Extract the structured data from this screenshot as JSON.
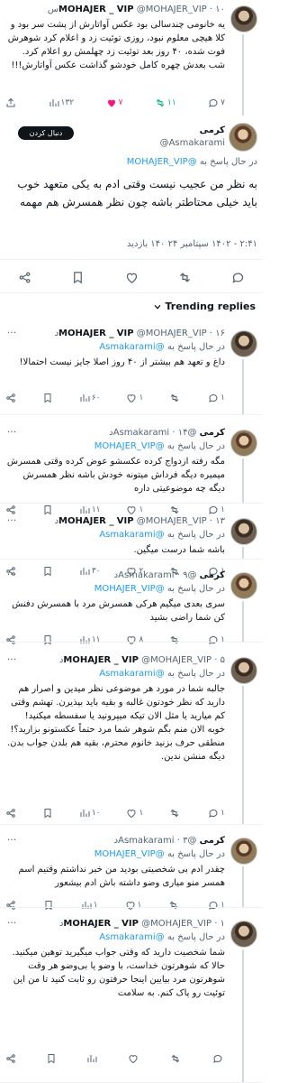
{
  "top_tweet": {
    "handle": "@MOHAJER_VIP",
    "name": "MOHAJER _ VIP",
    "time": "۱۰س",
    "text": "یه خانومی چندسالی بود عکس آواتارش از پشت سر بود و کلا هیچی معلوم نبود، روزی توئیت زد و اعلام کرد شوهرش فوت شده، ۴۰ روز بعد توئیت زد چهلمش رو اعلام کرد. شب بعدش چهره کامل خودشو گذاشت عکس آواتارش!!!",
    "stats": {
      "views": "۱۳۲",
      "retweets": "۱۱",
      "likes": "۷",
      "replies": "۷"
    }
  },
  "main_tweet": {
    "name": "کرمی",
    "handle": "@Asmakarami",
    "follow_label": "دنبال کردن",
    "reply_prefix": "در حال پاسخ به",
    "reply_to": "@MOHAJER_VIP",
    "text": "به نظر من عجیب نیست وقتی ادم به یکی متعهد خوب باید خیلی محتاطتر باشه چون نظر همسرش هم مهمه",
    "timestamp": "۲:۴۱ - ۱۴۰۲ سپتامبر ۲۴ ۱۴۰ بازدید"
  },
  "trending_label": "Trending replies",
  "replies": [
    {
      "name": "MOHAJER _ VIP",
      "handle": "@MOHAJER_VIP",
      "time": "۱۶د",
      "reply_to": "@Asmakarami",
      "text": "داغ و تعهد هم بیشتر از ۴۰ روز اصلا جایز نیست احتمالا!",
      "stats": {
        "replies": "۱",
        "retweets": "",
        "likes": "۱",
        "views": "۶۰"
      }
    },
    {
      "name": "کرمی",
      "handle": "@Asmakarami",
      "time": "۱۴د",
      "reply_to": "@MOHAJER_VIP",
      "text": "مگه رفته ازدواج کرده عکسشو عوض کرده وقتی همسرش میمیره دیگه فرداش میتونه خودش باشه نظر همسرش دیگه چه موضوعیتی داره",
      "stats": {
        "replies": "۱",
        "retweets": "",
        "likes": "۱",
        "views": "۱۱"
      }
    },
    {
      "name": "MOHAJER _ VIP",
      "handle": "@MOHAJER_VIP",
      "time": "۱۳د",
      "reply_to": "@Asmakarami",
      "text": "باشه شما درست میگین.",
      "stats": {
        "replies": "۱",
        "retweets": "",
        "likes": "۲",
        "views": "۳۰"
      }
    },
    {
      "name": "کرمی",
      "handle": "@Asmakarami",
      "time": "۹د",
      "reply_to": "@MOHAJER_VIP",
      "text": "سری بعدی میگیم هرکی همسرش مرد با همسرش دفنش کن شما راضی بشید",
      "stats": {
        "replies": "۱",
        "retweets": "",
        "likes": "۸",
        "views": "۱۱"
      }
    },
    {
      "name": "MOHAJER _ VIP",
      "handle": "@MOHAJER_VIP",
      "time": "۵د",
      "reply_to": "@Asmakarami",
      "text": "جالبه شما در مورد هر موضوعی نظر میدین و اصرار هم دارید که نظر خودتون غالبه و بقیه باید بپذیرن. تهشم وقتی کم میارید یا مثل الان تیکه میپرونید یا سفسطه میکنید! خوبه الان منم بگم شوهر شما مرد حتماً عکستونو بزارید؟! منطقی حرف بزنید خانوم محترم، بقیه هم بلدن جواب بدن. دیگه منشن ندین.",
      "stats": {
        "replies": "۱",
        "retweets": "",
        "likes": "۱",
        "views": "۱۰"
      }
    },
    {
      "name": "کرمی",
      "handle": "@Asmakarami",
      "time": "۳د",
      "reply_to": "@MOHAJER_VIP",
      "text": "چقدر ادم بی شخصیتی بودید من خبر نداشتم وقتیم اسم همسر منو میاری وضو داشته باش ادم بیشعور",
      "stats": {
        "replies": "۱",
        "retweets": "",
        "likes": "۱",
        "views": "۱"
      }
    },
    {
      "name": "MOHAJER _ VIP",
      "handle": "@MOHAJER_VIP",
      "time": "۱د",
      "reply_to": "@Asmakarami",
      "text": "شما شخصیت دارید که وقتی جواب میگیرید توهین میکنید. حالا که شوهرتون خداست، با وضو یا بی‌وضو هر وقت شوهرتون مرد بیایین اینجا حرفتون رو ثابت کنید تا من این توئیت رو پاک کنم. به سلامت",
      "stats": {
        "replies": "",
        "retweets": "",
        "likes": "",
        "views": ""
      }
    }
  ],
  "colors": {
    "accent": "#1d9bf0",
    "like": "#f91880",
    "retweet": "#00ba7c",
    "muted": "#536471",
    "text": "#0f1419"
  }
}
